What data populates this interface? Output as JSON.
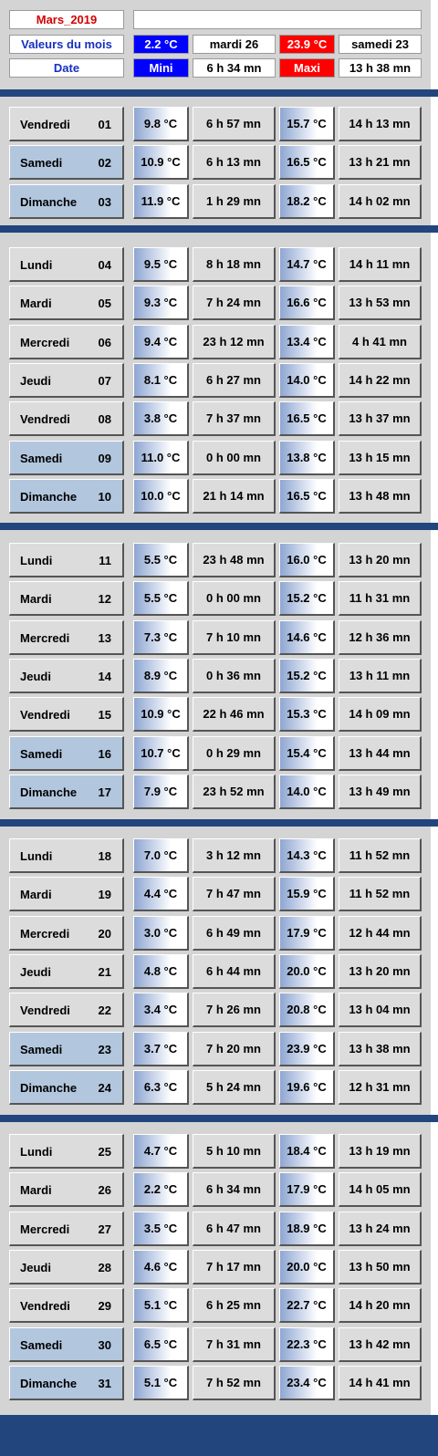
{
  "header": {
    "title": "Mars_2019",
    "title_right": "",
    "row_values": {
      "label": "Valeurs du mois",
      "min_value": "2.2 °C",
      "min_date": "mardi 26",
      "max_value": "23.9 °C",
      "max_date": "samedi 23"
    },
    "row_labels": {
      "label": "Date",
      "min_label": "Mini",
      "min_time": "6 h 34 mn",
      "max_label": "Maxi",
      "max_time": "13 h 38 mn"
    }
  },
  "colors": {
    "band": "#22457e",
    "panel": "#d4d4d4",
    "weekend": "#b2c6de",
    "mini_fill": "#0000ff",
    "maxi_fill": "#ff0000",
    "title_red": "#d40000",
    "label_blue": "#1530c0"
  },
  "weeks": [
    {
      "days": [
        {
          "name": "Vendredi",
          "num": "01",
          "min": "9.8 °C",
          "min_time": "6 h 57 mn",
          "max": "15.7 °C",
          "max_time": "14 h 13 mn"
        },
        {
          "name": "Samedi",
          "num": "02",
          "min": "10.9 °C",
          "min_time": "6 h 13 mn",
          "max": "16.5 °C",
          "max_time": "13 h 21 mn"
        },
        {
          "name": "Dimanche",
          "num": "03",
          "min": "11.9 °C",
          "min_time": "1 h 29 mn",
          "max": "18.2 °C",
          "max_time": "14 h 02 mn"
        }
      ]
    },
    {
      "days": [
        {
          "name": "Lundi",
          "num": "04",
          "min": "9.5 °C",
          "min_time": "8 h 18 mn",
          "max": "14.7 °C",
          "max_time": "14 h 11 mn"
        },
        {
          "name": "Mardi",
          "num": "05",
          "min": "9.3 °C",
          "min_time": "7 h 24 mn",
          "max": "16.6 °C",
          "max_time": "13 h 53 mn"
        },
        {
          "name": "Mercredi",
          "num": "06",
          "min": "9.4 °C",
          "min_time": "23 h 12 mn",
          "max": "13.4 °C",
          "max_time": "4 h 41 mn"
        },
        {
          "name": "Jeudi",
          "num": "07",
          "min": "8.1 °C",
          "min_time": "6 h 27 mn",
          "max": "14.0 °C",
          "max_time": "14 h 22 mn"
        },
        {
          "name": "Vendredi",
          "num": "08",
          "min": "3.8 °C",
          "min_time": "7 h 37 mn",
          "max": "16.5 °C",
          "max_time": "13 h 37 mn"
        },
        {
          "name": "Samedi",
          "num": "09",
          "min": "11.0 °C",
          "min_time": "0 h 00 mn",
          "max": "13.8 °C",
          "max_time": "13 h 15 mn"
        },
        {
          "name": "Dimanche",
          "num": "10",
          "min": "10.0 °C",
          "min_time": "21 h 14 mn",
          "max": "16.5 °C",
          "max_time": "13 h 48 mn"
        }
      ]
    },
    {
      "days": [
        {
          "name": "Lundi",
          "num": "11",
          "min": "5.5 °C",
          "min_time": "23 h 48 mn",
          "max": "16.0 °C",
          "max_time": "13 h 20 mn"
        },
        {
          "name": "Mardi",
          "num": "12",
          "min": "5.5 °C",
          "min_time": "0 h 00 mn",
          "max": "15.2 °C",
          "max_time": "11 h 31 mn"
        },
        {
          "name": "Mercredi",
          "num": "13",
          "min": "7.3 °C",
          "min_time": "7 h 10 mn",
          "max": "14.6 °C",
          "max_time": "12 h 36 mn"
        },
        {
          "name": "Jeudi",
          "num": "14",
          "min": "8.9 °C",
          "min_time": "0 h 36 mn",
          "max": "15.2 °C",
          "max_time": "13 h 11 mn"
        },
        {
          "name": "Vendredi",
          "num": "15",
          "min": "10.9 °C",
          "min_time": "22 h 46 mn",
          "max": "15.3 °C",
          "max_time": "14 h 09 mn"
        },
        {
          "name": "Samedi",
          "num": "16",
          "min": "10.7 °C",
          "min_time": "0 h 29 mn",
          "max": "15.4 °C",
          "max_time": "13 h 44 mn"
        },
        {
          "name": "Dimanche",
          "num": "17",
          "min": "7.9 °C",
          "min_time": "23 h 52 mn",
          "max": "14.0 °C",
          "max_time": "13 h 49 mn"
        }
      ]
    },
    {
      "days": [
        {
          "name": "Lundi",
          "num": "18",
          "min": "7.0 °C",
          "min_time": "3 h 12 mn",
          "max": "14.3 °C",
          "max_time": "11 h 52 mn"
        },
        {
          "name": "Mardi",
          "num": "19",
          "min": "4.4 °C",
          "min_time": "7 h 47 mn",
          "max": "15.9 °C",
          "max_time": "11 h 52 mn"
        },
        {
          "name": "Mercredi",
          "num": "20",
          "min": "3.0 °C",
          "min_time": "6 h 49 mn",
          "max": "17.9 °C",
          "max_time": "12 h 44 mn"
        },
        {
          "name": "Jeudi",
          "num": "21",
          "min": "4.8 °C",
          "min_time": "6 h 44 mn",
          "max": "20.0 °C",
          "max_time": "13 h 20 mn"
        },
        {
          "name": "Vendredi",
          "num": "22",
          "min": "3.4 °C",
          "min_time": "7 h 26 mn",
          "max": "20.8 °C",
          "max_time": "13 h 04 mn"
        },
        {
          "name": "Samedi",
          "num": "23",
          "min": "3.7 °C",
          "min_time": "7 h 20 mn",
          "max": "23.9 °C",
          "max_time": "13 h 38 mn"
        },
        {
          "name": "Dimanche",
          "num": "24",
          "min": "6.3 °C",
          "min_time": "5 h 24 mn",
          "max": "19.6 °C",
          "max_time": "12 h 31 mn"
        }
      ]
    },
    {
      "days": [
        {
          "name": "Lundi",
          "num": "25",
          "min": "4.7 °C",
          "min_time": "5 h 10 mn",
          "max": "18.4 °C",
          "max_time": "13 h 19 mn"
        },
        {
          "name": "Mardi",
          "num": "26",
          "min": "2.2 °C",
          "min_time": "6 h 34 mn",
          "max": "17.9 °C",
          "max_time": "14 h 05 mn"
        },
        {
          "name": "Mercredi",
          "num": "27",
          "min": "3.5 °C",
          "min_time": "6 h 47 mn",
          "max": "18.9 °C",
          "max_time": "13 h 24 mn"
        },
        {
          "name": "Jeudi",
          "num": "28",
          "min": "4.6 °C",
          "min_time": "7 h 17 mn",
          "max": "20.0 °C",
          "max_time": "13 h 50 mn"
        },
        {
          "name": "Vendredi",
          "num": "29",
          "min": "5.1 °C",
          "min_time": "6 h 25 mn",
          "max": "22.7 °C",
          "max_time": "14 h 20 mn"
        },
        {
          "name": "Samedi",
          "num": "30",
          "min": "6.5 °C",
          "min_time": "7 h 31 mn",
          "max": "22.3 °C",
          "max_time": "13 h 42 mn"
        },
        {
          "name": "Dimanche",
          "num": "31",
          "min": "5.1 °C",
          "min_time": "7 h 52 mn",
          "max": "23.4 °C",
          "max_time": "14 h 41 mn"
        }
      ]
    }
  ]
}
